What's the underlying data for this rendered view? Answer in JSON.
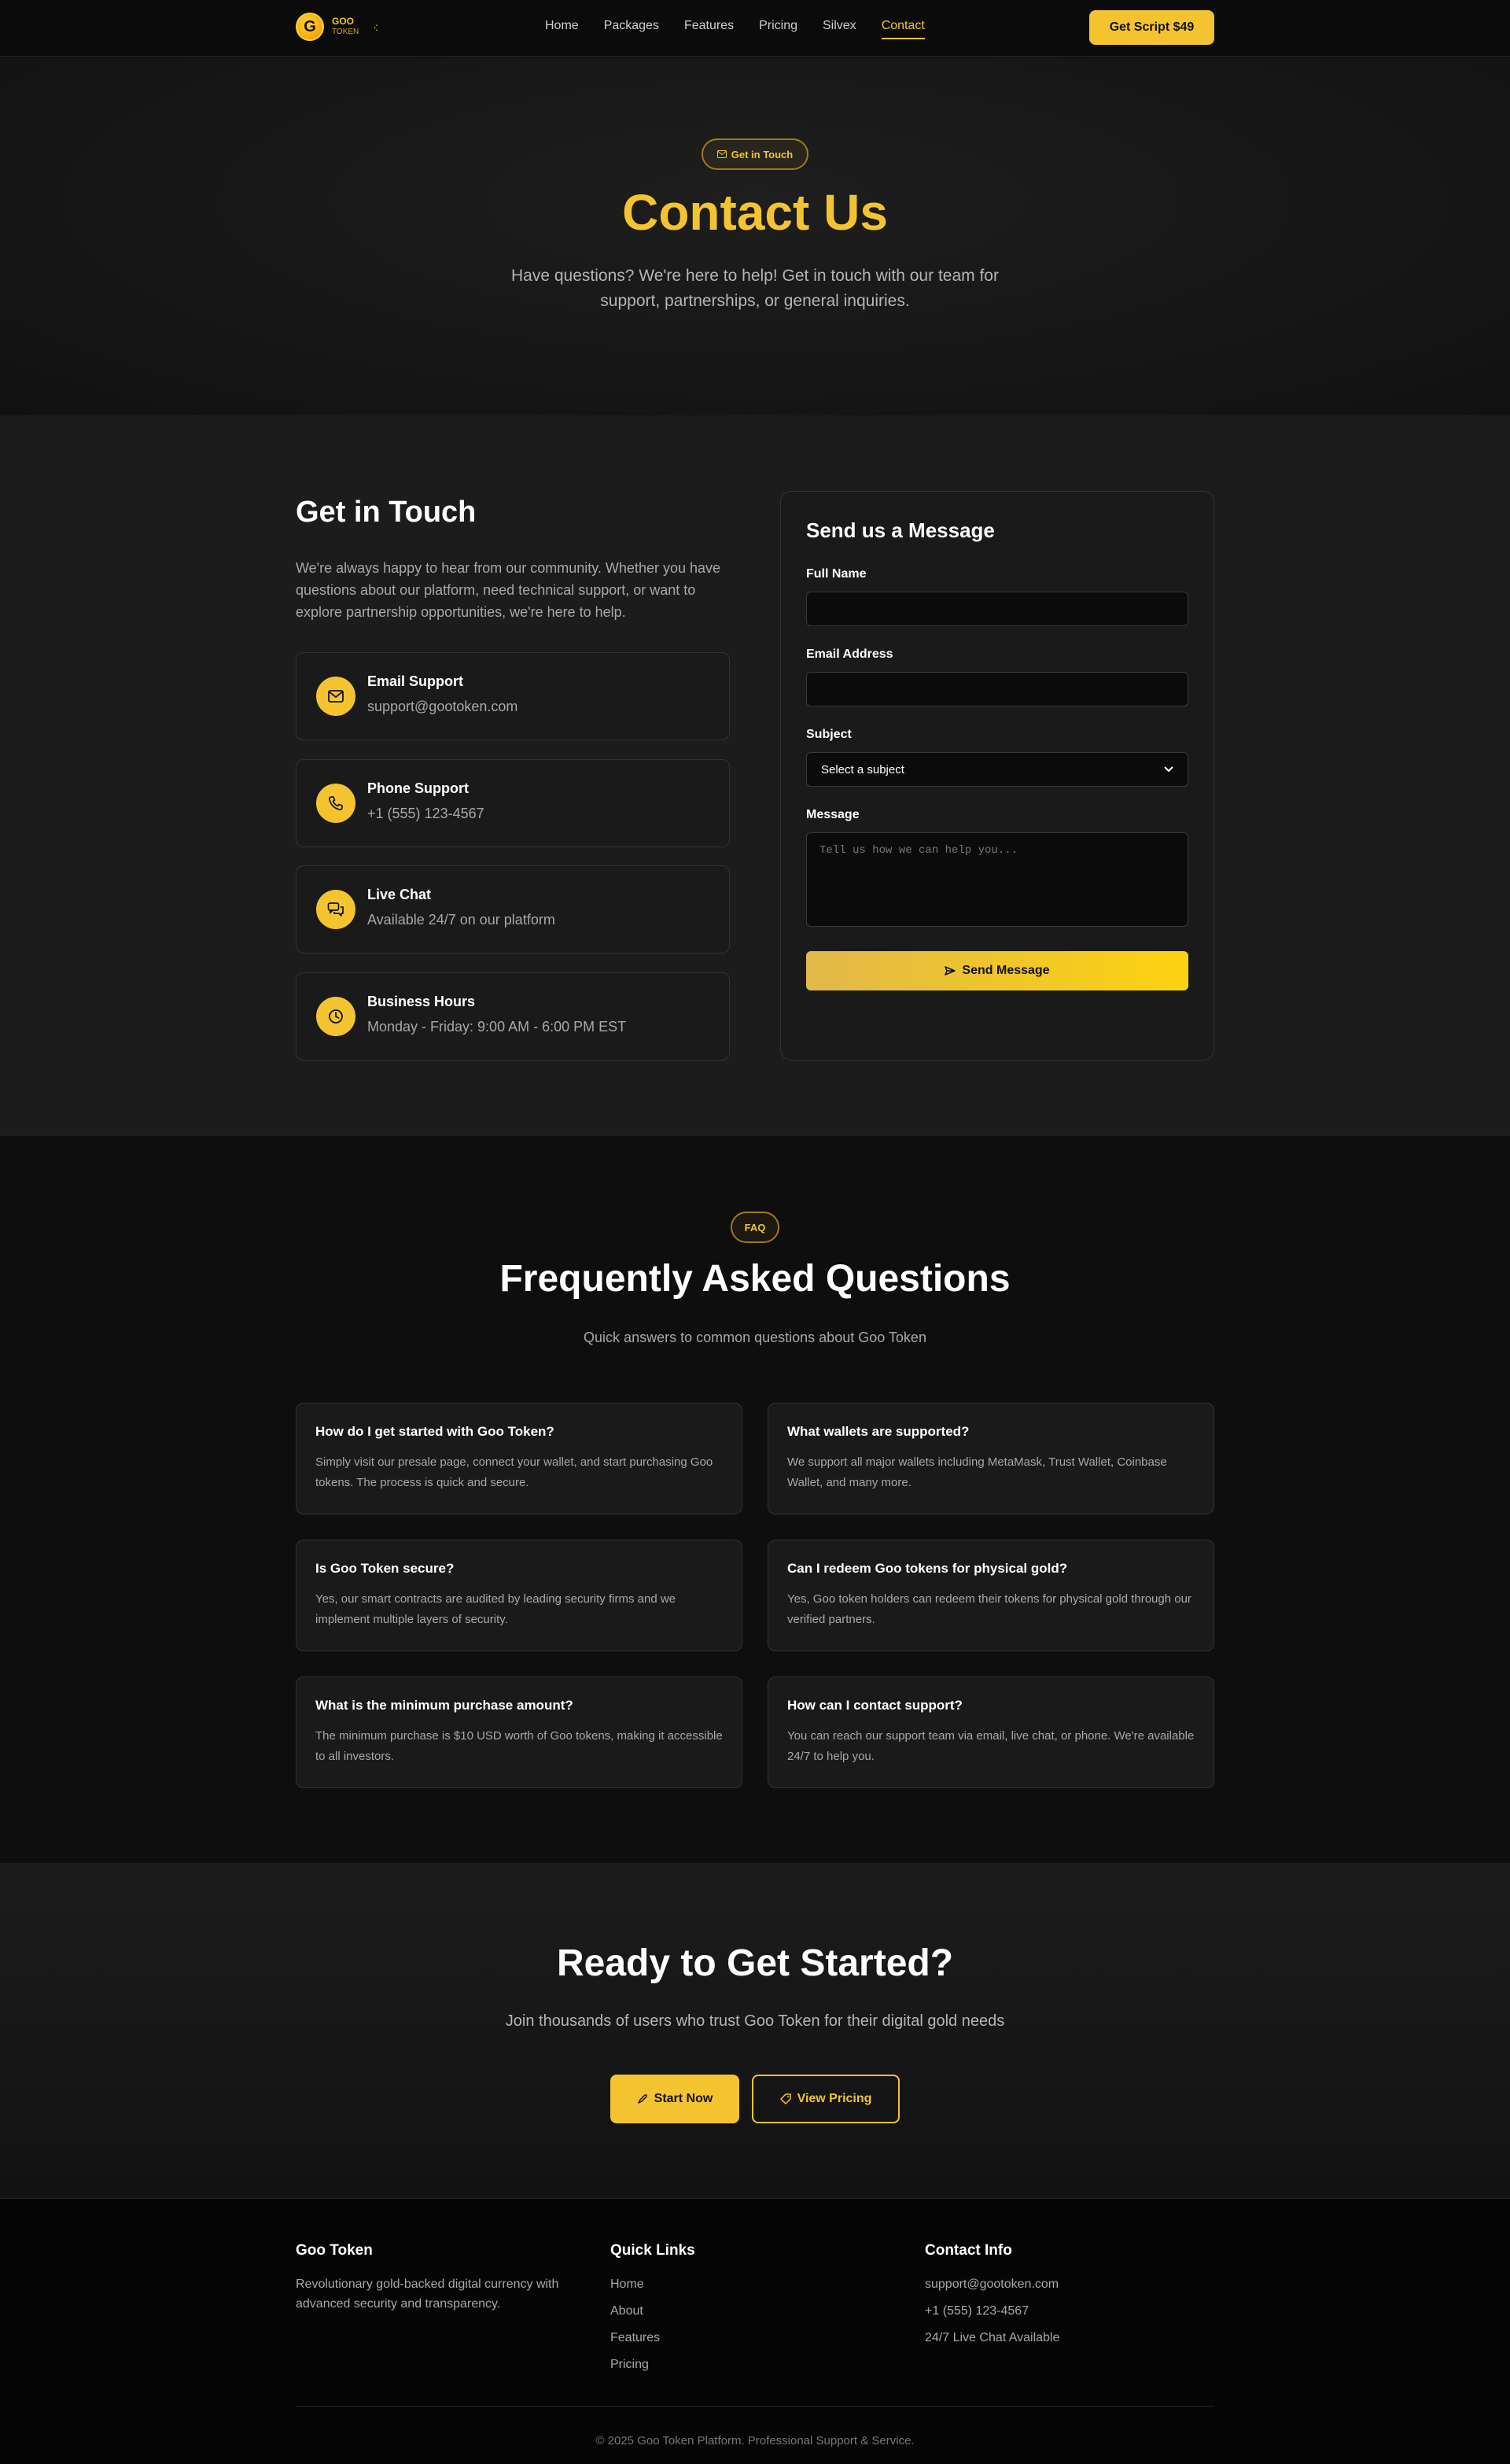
{
  "nav": {
    "logo_letter": "G",
    "logo_line1": "GOO",
    "logo_line2": "TOKEN",
    "links": [
      "Home",
      "Packages",
      "Features",
      "Pricing",
      "Silvex",
      "Contact"
    ],
    "active_link": "Contact",
    "cta_label": "Get Script $49"
  },
  "hero": {
    "badge": "Get in Touch",
    "title": "Contact Us",
    "subtitle": "Have questions? We're here to help! Get in touch with our team for support, partnerships, or general inquiries."
  },
  "contact": {
    "title": "Get in Touch",
    "description": "We're always happy to hear from our community. Whether you have questions about our platform, need technical support, or want to explore partnership opportunities, we're here to help.",
    "items": [
      {
        "icon": "mail-icon",
        "title": "Email Support",
        "value": "support@gootoken.com"
      },
      {
        "icon": "phone-icon",
        "title": "Phone Support",
        "value": "+1 (555) 123-4567"
      },
      {
        "icon": "chat-icon",
        "title": "Live Chat",
        "value": "Available 24/7 on our platform"
      },
      {
        "icon": "clock-icon",
        "title": "Business Hours",
        "value": "Monday - Friday: 9:00 AM - 6:00 PM EST"
      }
    ]
  },
  "form": {
    "title": "Send us a Message",
    "name_label": "Full Name",
    "name_value": "",
    "email_label": "Email Address",
    "email_value": "",
    "subject_label": "Subject",
    "subject_selected": "Select a subject",
    "message_label": "Message",
    "message_placeholder": "Tell us how we can help you...",
    "submit_label": "Send Message"
  },
  "faq": {
    "badge": "FAQ",
    "title": "Frequently Asked Questions",
    "subtitle": "Quick answers to common questions about Goo Token",
    "items": [
      {
        "q": "How do I get started with Goo Token?",
        "a": "Simply visit our presale page, connect your wallet, and start purchasing Goo tokens. The process is quick and secure."
      },
      {
        "q": "What wallets are supported?",
        "a": "We support all major wallets including MetaMask, Trust Wallet, Coinbase Wallet, and many more."
      },
      {
        "q": "Is Goo Token secure?",
        "a": "Yes, our smart contracts are audited by leading security firms and we implement multiple layers of security."
      },
      {
        "q": "Can I redeem Goo tokens for physical gold?",
        "a": "Yes, Goo token holders can redeem their tokens for physical gold through our verified partners."
      },
      {
        "q": "What is the minimum purchase amount?",
        "a": "The minimum purchase is $10 USD worth of Goo tokens, making it accessible to all investors."
      },
      {
        "q": "How can I contact support?",
        "a": "You can reach our support team via email, live chat, or phone. We're available 24/7 to help you."
      }
    ]
  },
  "cta": {
    "title": "Ready to Get Started?",
    "subtitle": "Join thousands of users who trust Goo Token for their digital gold needs",
    "start_label": "Start Now",
    "pricing_label": "View Pricing"
  },
  "footer": {
    "col1_title": "Goo Token",
    "col1_text": "Revolutionary gold-backed digital currency with advanced security and transparency.",
    "col2_title": "Quick Links",
    "col2_links": [
      "Home",
      "About",
      "Features",
      "Pricing"
    ],
    "col3_title": "Contact Info",
    "col3_items": [
      "support@gootoken.com",
      "+1 (555) 123-4567",
      "24/7 Live Chat Available"
    ],
    "copyright": "© 2025 Goo Token Platform. Professional Support & Service."
  },
  "colors": {
    "accent": "#f4c430",
    "background": "#0b0b0b",
    "section": "#1c1c1c"
  }
}
